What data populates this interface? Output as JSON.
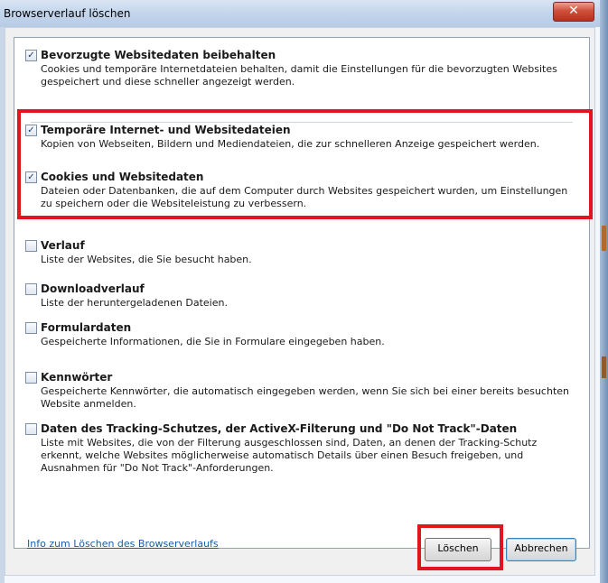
{
  "window": {
    "title": "Browserverlauf löschen",
    "close_glyph": "✕"
  },
  "options": [
    {
      "checked": true,
      "label": "Bevorzugte Websitedaten beibehalten",
      "description": "Cookies und temporäre Internetdateien behalten, damit die Einstellungen für die bevorzugten Websites gespeichert und diese schneller angezeigt werden."
    },
    {
      "checked": true,
      "label": "Temporäre Internet- und Websitedateien",
      "description": "Kopien von Webseiten, Bildern und Mediendateien, die zur schnelleren Anzeige gespeichert werden."
    },
    {
      "checked": true,
      "label": "Cookies und Websitedaten",
      "description": "Dateien oder Datenbanken, die auf dem Computer durch Websites gespeichert wurden, um Einstellungen zu speichern oder die Websiteleistung zu verbessern."
    },
    {
      "checked": false,
      "label": "Verlauf",
      "description": "Liste der Websites, die Sie besucht haben."
    },
    {
      "checked": false,
      "label": "Downloadverlauf",
      "description": "Liste der heruntergeladenen Dateien."
    },
    {
      "checked": false,
      "label": "Formulardaten",
      "description": "Gespeicherte Informationen, die Sie in Formulare eingegeben haben."
    },
    {
      "checked": false,
      "label": "Kennwörter",
      "description": "Gespeicherte Kennwörter, die automatisch eingegeben werden, wenn Sie sich bei einer bereits besuchten Website anmelden."
    },
    {
      "checked": false,
      "label": "Daten des Tracking-Schutzes, der ActiveX-Filterung und \"Do Not Track\"-Daten",
      "description": "Liste mit Websites, die von der Filterung ausgeschlossen sind, Daten, an denen der Tracking-Schutz erkennt, welche Websites möglicherweise automatisch Details über einen Besuch freigeben, und Ausnahmen für \"Do Not Track\"-Anforderungen."
    }
  ],
  "footer": {
    "info_link": "Info zum Löschen des Browserverlaufs",
    "delete_label": "Löschen",
    "cancel_label": "Abbrechen"
  },
  "colors": {
    "highlight": "#e0151e",
    "link": "#1e5aa8"
  }
}
